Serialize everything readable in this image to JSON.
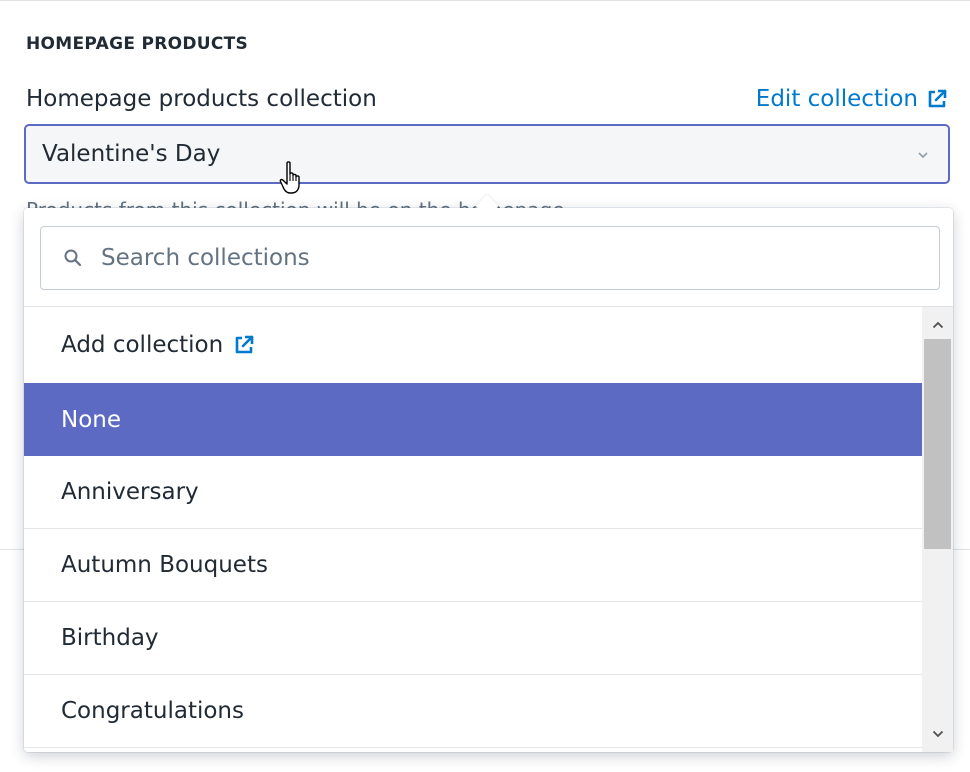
{
  "section": {
    "title": "HOMEPAGE PRODUCTS"
  },
  "field": {
    "label": "Homepage products collection",
    "edit_link": "Edit collection",
    "selected_value": "Valentine's Day",
    "help_text": "Products from this collection will be on the homepage."
  },
  "popover": {
    "search_placeholder": "Search collections",
    "add_label": "Add collection",
    "selected_option": "None",
    "options": [
      "Anniversary",
      "Autumn Bouquets",
      "Birthday",
      "Congratulations"
    ]
  },
  "colors": {
    "accent": "#5c6ac4",
    "link": "#007ace",
    "text": "#212b36",
    "subdued": "#637381",
    "border": "#dfe3e8"
  },
  "icons": {
    "external_link": "external-link-icon",
    "search": "search-icon",
    "chevron": "chevron-down-icon",
    "cursor": "hand-pointer-icon"
  }
}
